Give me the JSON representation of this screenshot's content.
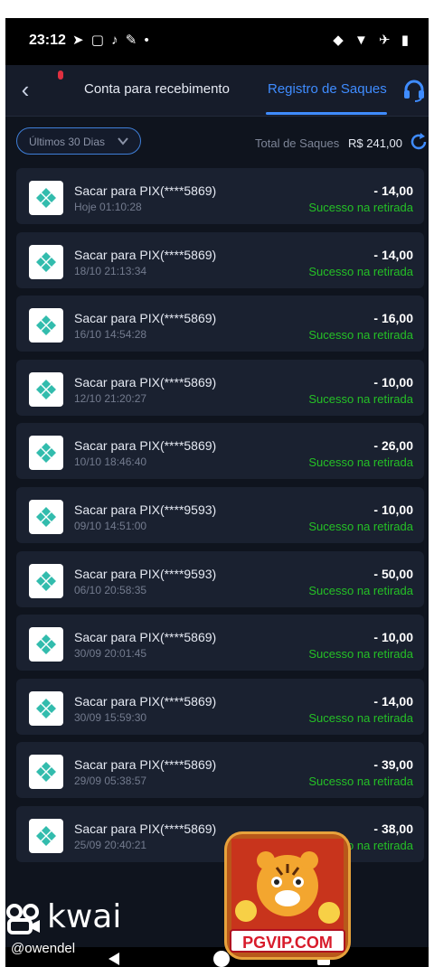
{
  "status_bar": {
    "time": "23:12",
    "left_icons": "➤ ▢ ♪ ✎ •",
    "right_icons": "◆ ▼ ✈ ▮"
  },
  "header": {
    "tabs": [
      {
        "label": "Conta para recebimento",
        "active": false
      },
      {
        "label": "Registro de Saques",
        "active": true
      }
    ],
    "back_icon": "chevron-left-icon",
    "support_icon": "headset-icon"
  },
  "filter": {
    "selected": "Últimos 30 Dias",
    "total_label": "Total de Saques",
    "total_value": "R$ 241,00"
  },
  "withdrawals": [
    {
      "title": "Sacar para PIX(****5869)",
      "date": "Hoje 01:10:28",
      "amount": "- 14,00",
      "status": "Sucesso na retirada"
    },
    {
      "title": "Sacar para PIX(****5869)",
      "date": "18/10 21:13:34",
      "amount": "- 14,00",
      "status": "Sucesso na retirada"
    },
    {
      "title": "Sacar para PIX(****5869)",
      "date": "16/10 14:54:28",
      "amount": "- 16,00",
      "status": "Sucesso na retirada"
    },
    {
      "title": "Sacar para PIX(****5869)",
      "date": "12/10 21:20:27",
      "amount": "- 10,00",
      "status": "Sucesso na retirada"
    },
    {
      "title": "Sacar para PIX(****5869)",
      "date": "10/10 18:46:40",
      "amount": "- 26,00",
      "status": "Sucesso na retirada"
    },
    {
      "title": "Sacar para PIX(****9593)",
      "date": "09/10 14:51:00",
      "amount": "- 10,00",
      "status": "Sucesso na retirada"
    },
    {
      "title": "Sacar para PIX(****9593)",
      "date": "06/10 20:58:35",
      "amount": "- 50,00",
      "status": "Sucesso na retirada"
    },
    {
      "title": "Sacar para PIX(****5869)",
      "date": "30/09 20:01:45",
      "amount": "- 10,00",
      "status": "Sucesso na retirada"
    },
    {
      "title": "Sacar para PIX(****5869)",
      "date": "30/09 15:59:30",
      "amount": "- 14,00",
      "status": "Sucesso na retirada"
    },
    {
      "title": "Sacar para PIX(****5869)",
      "date": "29/09 05:38:57",
      "amount": "- 39,00",
      "status": "Sucesso na retirada"
    },
    {
      "title": "Sacar para PIX(****5869)",
      "date": "25/09 20:40:21",
      "amount": "- 38,00",
      "status": "Sucesso na retirada"
    }
  ],
  "watermark": {
    "brand": "kwai",
    "handle": "@owendel"
  },
  "promo": {
    "label": "PGVIP.COM"
  },
  "colors": {
    "accent": "#3f8cff",
    "success": "#25c026",
    "background": "#0f141e",
    "card": "#1a2130",
    "pix": "#32bcad"
  }
}
